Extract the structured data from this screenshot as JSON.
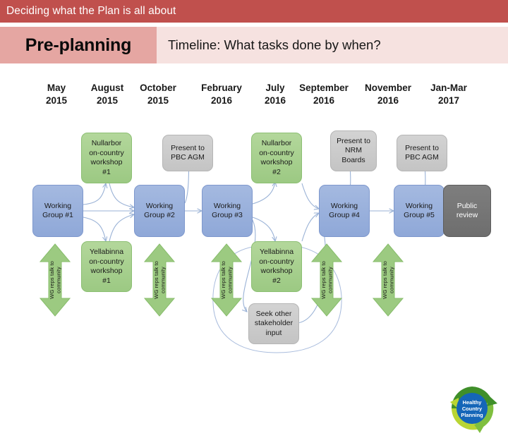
{
  "header": {
    "title": "Deciding what the Plan is all about"
  },
  "subheader": {
    "phase_label": "Pre-planning",
    "caption": "Timeline: What tasks done by when?"
  },
  "colors": {
    "header_red": "#c0504d",
    "phase_chip": "#e5a6a2",
    "subheader_bg": "#f6e2e0",
    "green": "#a8d08d",
    "blue": "#8fa8d8",
    "grey": "#c9c9c9",
    "dark_grey": "#767676",
    "logo_blue": "#1f6fc4",
    "logo_green": "#4f9c2f",
    "logo_lime": "#b5d334"
  },
  "timeline": {
    "dates": [
      {
        "month": "May",
        "year": "2015"
      },
      {
        "month": "August",
        "year": "2015"
      },
      {
        "month": "October",
        "year": "2015"
      },
      {
        "month": "February",
        "year": "2016"
      },
      {
        "month": "July",
        "year": "2016"
      },
      {
        "month": "September",
        "year": "2016"
      },
      {
        "month": "November",
        "year": "2016"
      },
      {
        "month": "Jan-Mar",
        "year": "2017"
      }
    ],
    "top_row": [
      {
        "label": "Nullarbor\non-country\nworkshop\n#1",
        "style": "green"
      },
      {
        "label": "Present to\nPBC AGM",
        "style": "grey"
      },
      {
        "label": "Nullarbor\non-country\nworkshop\n#2",
        "style": "green"
      },
      {
        "label": "Present to\nNRM\nBoards",
        "style": "grey"
      },
      {
        "label": "Present to\nPBC AGM",
        "style": "grey"
      }
    ],
    "middle_row": [
      {
        "label": "Working\nGroup #1",
        "style": "blue"
      },
      {
        "label": "Working\nGroup #2",
        "style": "blue"
      },
      {
        "label": "Working\nGroup #3",
        "style": "blue"
      },
      {
        "label": "Working\nGroup #4",
        "style": "blue"
      },
      {
        "label": "Working\nGroup #5",
        "style": "blue"
      },
      {
        "label": "Public\nreview",
        "style": "darkgrey"
      }
    ],
    "bottom_row": [
      {
        "label": "Yellabinna\non-country\nworkshop\n#1",
        "style": "green"
      },
      {
        "label": "Yellabinna\non-country\nworkshop\n#2",
        "style": "green"
      },
      {
        "label": "Seek other\nstakeholder\ninput",
        "style": "grey"
      }
    ],
    "community_arrow_label": "WG reps talk to\ncommunity",
    "community_arrow_count": 5
  },
  "logo": {
    "line1": "Healthy",
    "line2": "Country",
    "line3": "Planning"
  }
}
